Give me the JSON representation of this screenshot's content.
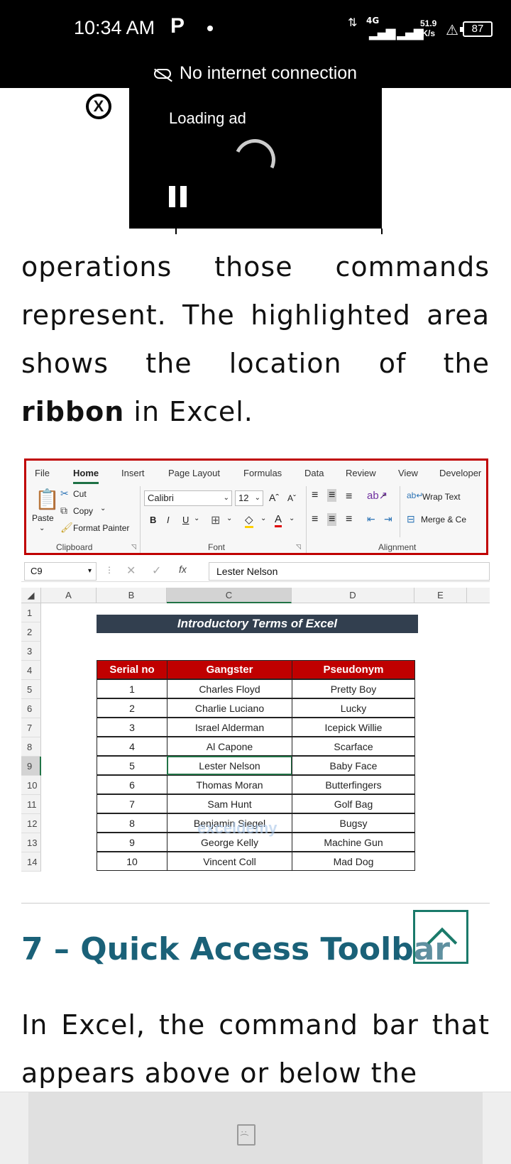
{
  "status_bar": {
    "time": "10:34 AM",
    "app_icon": "P",
    "network_type": "4G",
    "speed_value": "51.9",
    "speed_unit": "K/s",
    "battery": "87"
  },
  "banner": {
    "text": "No internet connection"
  },
  "ad": {
    "text": "Loading ad"
  },
  "article": {
    "para1_before": "operations those commands represent. The highlighted area shows the location of the ",
    "para1_bold": "ribbon",
    "para1_after": " in Excel.",
    "heading": "7 – Quick Access Toolbar",
    "para2": "In Excel, the command bar that appears above or below the"
  },
  "excel": {
    "tabs": [
      "File",
      "Home",
      "Insert",
      "Page Layout",
      "Formulas",
      "Data",
      "Review",
      "View",
      "Developer"
    ],
    "clipboard": {
      "paste": "Paste",
      "cut": "Cut",
      "copy": "Copy",
      "format_painter": "Format Painter",
      "label": "Clipboard"
    },
    "font": {
      "name": "Calibri",
      "size": "12",
      "bold": "B",
      "italic": "I",
      "underline": "U",
      "label": "Font"
    },
    "alignment": {
      "wrap_text": "Wrap Text",
      "merge": "Merge & Ce",
      "label": "Alignment"
    },
    "name_box": "C9",
    "formula_value": "Lester Nelson",
    "columns": [
      "A",
      "B",
      "C",
      "D",
      "E"
    ],
    "rows": [
      "1",
      "2",
      "3",
      "4",
      "5",
      "6",
      "7",
      "8",
      "9",
      "10",
      "11",
      "12",
      "13",
      "14"
    ],
    "table_title": "Introductory Terms of Excel",
    "headers": [
      "Serial no",
      "Gangster",
      "Pseudonym"
    ],
    "data": [
      [
        "1",
        "Charles Floyd",
        "Pretty Boy"
      ],
      [
        "2",
        "Charlie Luciano",
        "Lucky"
      ],
      [
        "3",
        "Israel Alderman",
        "Icepick Willie"
      ],
      [
        "4",
        "Al Capone",
        "Scarface"
      ],
      [
        "5",
        "Lester Nelson",
        "Baby Face"
      ],
      [
        "6",
        "Thomas Moran",
        "Butterfingers"
      ],
      [
        "7",
        "Sam Hunt",
        "Golf Bag"
      ],
      [
        "8",
        "Benjamin Siegel",
        "Bugsy"
      ],
      [
        "9",
        "George Kelly",
        "Machine Gun"
      ],
      [
        "10",
        "Vincent Coll",
        "Mad Dog"
      ]
    ],
    "watermark": "exceldemy"
  },
  "colors": {
    "ribbon_highlight": "#c00000",
    "table_header": "#c00000",
    "title_bar": "#323f4f",
    "heading": "#1a6178",
    "excel_green": "#217346"
  }
}
